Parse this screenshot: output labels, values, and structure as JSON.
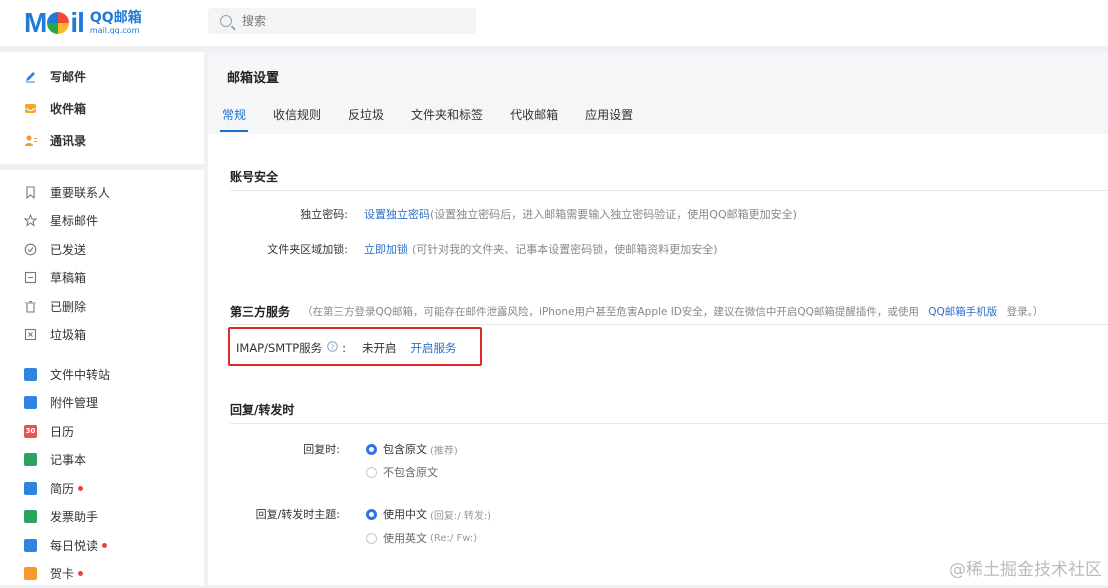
{
  "topbar": {
    "logo_mail": "Mail",
    "logo_qq": "QQ邮箱",
    "logo_url": "mail.qq.com",
    "search_placeholder": "搜索"
  },
  "sidebar": {
    "primary": [
      {
        "label": "写邮件",
        "icon": "pen-icon"
      },
      {
        "label": "收件箱",
        "icon": "inbox-icon"
      },
      {
        "label": "通讯录",
        "icon": "contacts-icon"
      }
    ],
    "folders": [
      {
        "label": "重要联系人",
        "icon": "bookmark-icon"
      },
      {
        "label": "星标邮件",
        "icon": "star-icon"
      },
      {
        "label": "已发送",
        "icon": "check-circle-icon"
      },
      {
        "label": "草稿箱",
        "icon": "draft-icon"
      },
      {
        "label": "已删除",
        "icon": "trash-icon"
      },
      {
        "label": "垃圾箱",
        "icon": "spam-icon"
      }
    ],
    "apps": [
      {
        "label": "文件中转站",
        "icon": "transfer-icon"
      },
      {
        "label": "附件管理",
        "icon": "attachment-icon"
      },
      {
        "label": "日历",
        "icon": "calendar-icon",
        "icon_text": "30"
      },
      {
        "label": "记事本",
        "icon": "notepad-icon"
      },
      {
        "label": "简历",
        "icon": "resume-icon",
        "dot": true
      },
      {
        "label": "发票助手",
        "icon": "invoice-icon"
      },
      {
        "label": "每日悦读",
        "icon": "reading-icon",
        "dot": true
      },
      {
        "label": "贺卡",
        "icon": "card-icon",
        "dot": true
      }
    ]
  },
  "main": {
    "title": "邮箱设置",
    "tabs": [
      "常规",
      "收信规则",
      "反垃圾",
      "文件夹和标签",
      "代收邮箱",
      "应用设置"
    ],
    "account_security": {
      "title": "账号安全",
      "password_label": "独立密码:",
      "password_link": "设置独立密码",
      "password_desc": "(设置独立密码后，进入邮箱需要输入独立密码验证，使用QQ邮箱更加安全)",
      "folder_lock_label": "文件夹区域加锁:",
      "folder_lock_link": "立即加锁",
      "folder_lock_desc": "(可针对我的文件夹、记事本设置密码锁，使邮箱资料更加安全)"
    },
    "third_party": {
      "title": "第三方服务",
      "desc_prefix": "（在第三方登录QQ邮箱，可能存在邮件泄露风险，iPhone用户甚至危害Apple ID安全，建议在微信中开启QQ邮箱提醒插件，或使用",
      "desc_link": "QQ邮箱手机版",
      "desc_suffix": "登录。）",
      "imap_label": "IMAP/SMTP服务",
      "imap_colon": ":",
      "imap_status": "未开启",
      "imap_link": "开启服务"
    },
    "reply": {
      "title": "回复/转发时",
      "reply_label": "回复时:",
      "reply_opt1": "包含原文",
      "reply_opt1_hint": "(推荐)",
      "reply_opt2": "不包含原文",
      "subject_label": "回复/转发时主题:",
      "subject_opt1": "使用中文",
      "subject_opt1_hint": "(回复:/ 转发:)",
      "subject_opt2": "使用英文",
      "subject_opt2_hint": "(Re:/ Fw:)"
    }
  },
  "watermark": "@稀土掘金技术社区"
}
